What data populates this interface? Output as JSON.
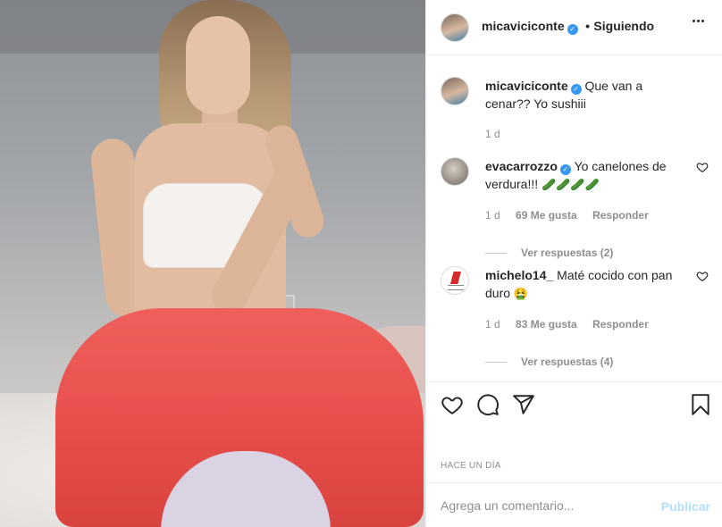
{
  "post": {
    "author": "micaviciconte",
    "follow_status": "Siguiendo",
    "caption": "Que van a cenar?? Yo sushiii",
    "caption_age": "1 d"
  },
  "comments": [
    {
      "username": "evacarrozzo",
      "verified": true,
      "text": "Yo canelones de verdura!!!",
      "emoji": "🥒🥒🥒🥒",
      "age": "1 d",
      "likes": "69 Me gusta",
      "reply_label": "Responder",
      "view_replies": "Ver respuestas (2)"
    },
    {
      "username": "michelo14_",
      "verified": false,
      "text": "Maté cocido con pan duro",
      "emoji": "🤮",
      "age": "1 d",
      "likes": "83 Me gusta",
      "reply_label": "Responder",
      "view_replies": "Ver respuestas (4)"
    }
  ],
  "timestamp": "HACE UN DÍA",
  "add_comment": {
    "placeholder": "Agrega un comentario...",
    "publish_label": "Publicar"
  },
  "icons": {
    "verified": "verified-badge-icon",
    "more": "more-options-icon",
    "like": "heart-icon",
    "comment": "comment-icon",
    "share": "paper-plane-icon",
    "save": "bookmark-icon"
  },
  "colors": {
    "verified": "#3897f0",
    "publish_disabled": "#b2dffc",
    "muted_text": "#8e8e8e"
  }
}
